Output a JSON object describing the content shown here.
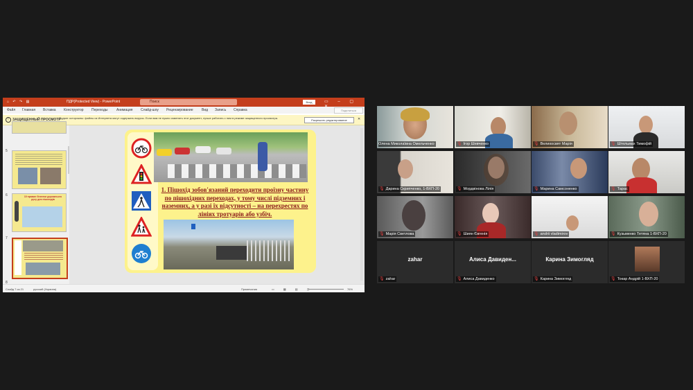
{
  "ppt": {
    "title": "ПДР(Protected View) - PowerPoint",
    "search": "Поиск",
    "signin": "Вход",
    "share": "Поделиться",
    "menu": [
      "Файл",
      "Главная",
      "Вставка",
      "Конструктор",
      "Переходы",
      "Анимация",
      "Слайд-шоу",
      "Рецензирование",
      "Вид",
      "Запись",
      "Справка"
    ],
    "warn_label": "ЗАЩИЩЕННЫЙ ПРОСМОТР",
    "warn_text": "Будьте осторожны: файлы из Интернета могут содержать вирусы. Если вам не нужно изменять этот документ, лучше работать с ним в режиме защищенного просмотра.",
    "warn_button": "Разрешить редактирование",
    "thumb_numbers": [
      "5",
      "6",
      "7",
      "8"
    ],
    "thumb6_text": "10 правил безпеки дорожнього руху для пішоходів",
    "slide_text": "1. Пішохід зобов'язаний переходити проїзну частину по пішохідних переходах, у тому числі підземних і наземних, а у разі їх відсутності – на перехрестях по лініях тротуарів або узбіч.",
    "status_slide": "Слайд 7 из 21",
    "status_lang": "русский (Украина)",
    "status_notes": "Примечания",
    "zoom": "76%"
  },
  "participants": [
    {
      "name": "Олена Миколаївна Омельченко",
      "muted": false
    },
    {
      "name": "Ігор Шевченко",
      "muted": true
    },
    {
      "name": "Велихосвят Марія",
      "muted": true
    },
    {
      "name": "Штельмах Тимофій",
      "muted": true
    },
    {
      "name": "Дарина Скрипченко, 1-ВХП-20",
      "muted": true
    },
    {
      "name": "Мордвінова Лілія",
      "muted": true
    },
    {
      "name": "Марина Самсоненко",
      "muted": true
    },
    {
      "name": "Тарас",
      "muted": true
    },
    {
      "name": "Марія Светлова",
      "muted": true
    },
    {
      "name": "Шиян Євгенія",
      "muted": true
    },
    {
      "name": "andrii vladimirov",
      "muted": true
    },
    {
      "name": "Кузьменко Тетяна 1-ВХП-20",
      "muted": true
    },
    {
      "name": "zahar",
      "center": "zahar",
      "muted": true
    },
    {
      "name": "Алиса Давиденко",
      "center": "Алиса  Давиден...",
      "muted": true
    },
    {
      "name": "Карина Зимогляд",
      "center": "Карина Зимогляд",
      "muted": true
    },
    {
      "name": "Токар Андрій 1-ВХП-20",
      "muted": true
    }
  ],
  "colors": {
    "ppt_red": "#c43e1c",
    "active_speaker": "#c8d830",
    "muted_red": "#e04040"
  }
}
